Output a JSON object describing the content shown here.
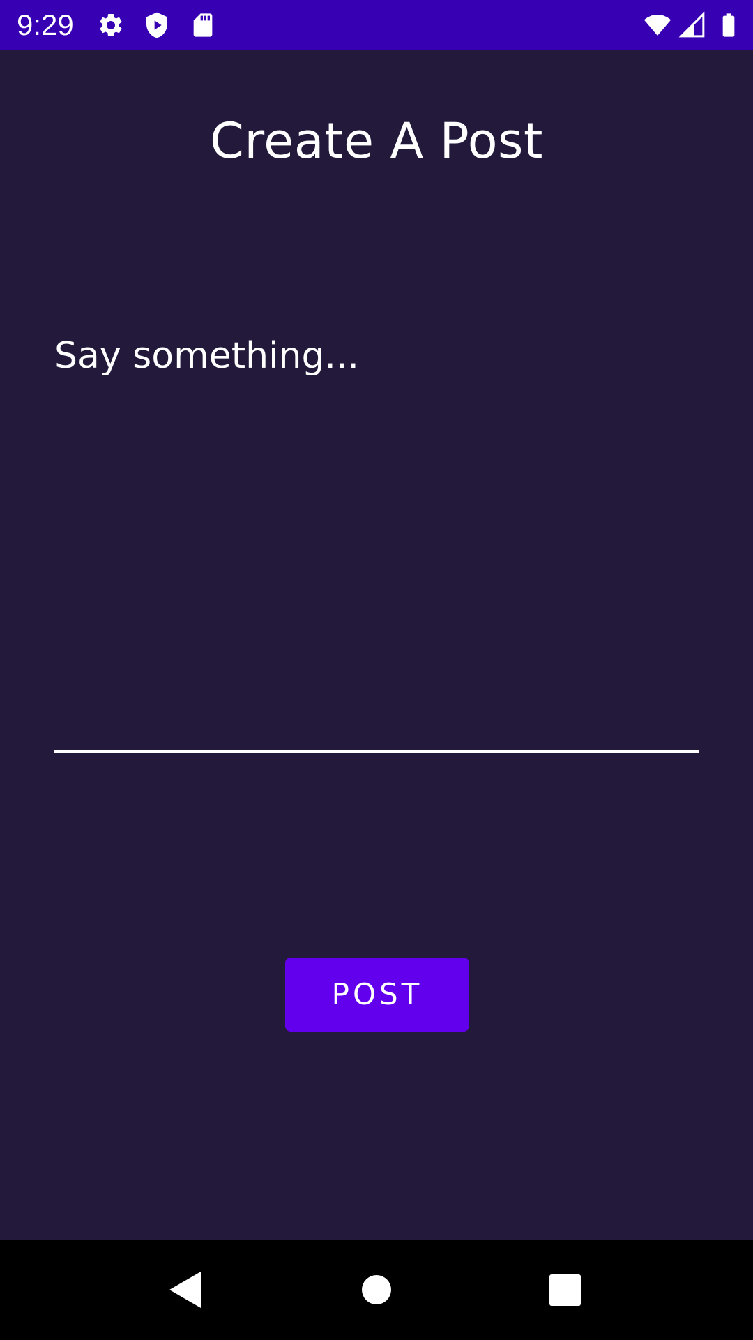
{
  "status_bar": {
    "time": "9:29",
    "background": "#3700b3",
    "left_icons": [
      "gear-icon",
      "shield-play-icon",
      "sd-card-icon"
    ],
    "right_icons": [
      "wifi-icon",
      "cellular-signal-icon",
      "battery-icon"
    ]
  },
  "page": {
    "title": "Create A Post",
    "background": "#231a3b"
  },
  "post_input": {
    "value": "",
    "placeholder": "Say something..."
  },
  "post_button": {
    "label": "POST",
    "color": "#6200ee"
  },
  "nav_bar": {
    "buttons": [
      "back-icon",
      "home-icon",
      "recents-icon"
    ]
  }
}
